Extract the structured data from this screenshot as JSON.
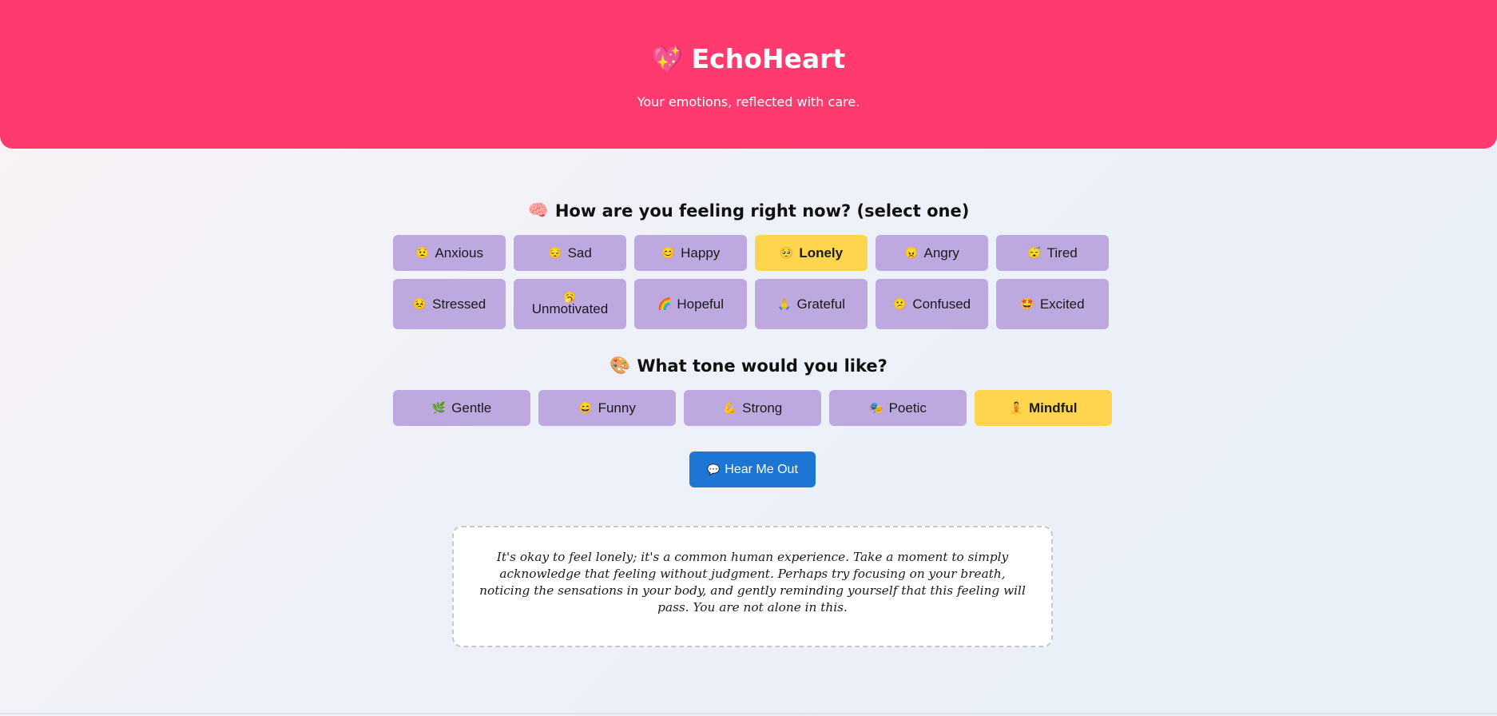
{
  "header": {
    "logo_icon": "💖",
    "title": "EchoHeart",
    "subtitle": "Your emotions, reflected with care."
  },
  "mood_section": {
    "icon": "🧠",
    "title": "How are you feeling right now? (select one)",
    "options": [
      {
        "emoji": "😟",
        "label": "Anxious",
        "selected": false
      },
      {
        "emoji": "😔",
        "label": "Sad",
        "selected": false
      },
      {
        "emoji": "😊",
        "label": "Happy",
        "selected": false
      },
      {
        "emoji": "🥺",
        "label": "Lonely",
        "selected": true
      },
      {
        "emoji": "😠",
        "label": "Angry",
        "selected": false
      },
      {
        "emoji": "😴",
        "label": "Tired",
        "selected": false
      },
      {
        "emoji": "😣",
        "label": "Stressed",
        "selected": false
      },
      {
        "emoji": "🥱",
        "label": "Unmotivated",
        "selected": false
      },
      {
        "emoji": "🌈",
        "label": "Hopeful",
        "selected": false
      },
      {
        "emoji": "🙏",
        "label": "Grateful",
        "selected": false
      },
      {
        "emoji": "😕",
        "label": "Confused",
        "selected": false
      },
      {
        "emoji": "🤩",
        "label": "Excited",
        "selected": false
      }
    ]
  },
  "tone_section": {
    "icon": "🎨",
    "title": "What tone would you like?",
    "options": [
      {
        "emoji": "🌿",
        "label": "Gentle",
        "selected": false
      },
      {
        "emoji": "😄",
        "label": "Funny",
        "selected": false
      },
      {
        "emoji": "💪",
        "label": "Strong",
        "selected": false
      },
      {
        "emoji": "🎭",
        "label": "Poetic",
        "selected": false
      },
      {
        "emoji": "🧘",
        "label": "Mindful",
        "selected": true
      }
    ]
  },
  "action": {
    "icon": "💬",
    "label": "Hear Me Out"
  },
  "response": {
    "text": "It's okay to feel lonely; it's a common human experience. Take a moment to simply acknowledge that feeling without judgment. Perhaps try focusing on your breath, noticing the sensations in your body, and gently reminding yourself that this feeling will pass. You are not alone in this."
  },
  "colors": {
    "header_bg": "#ff3a6e",
    "option_bg": "#bda9e0",
    "option_selected_bg": "#ffd54f",
    "button_bg": "#1e76d4"
  }
}
